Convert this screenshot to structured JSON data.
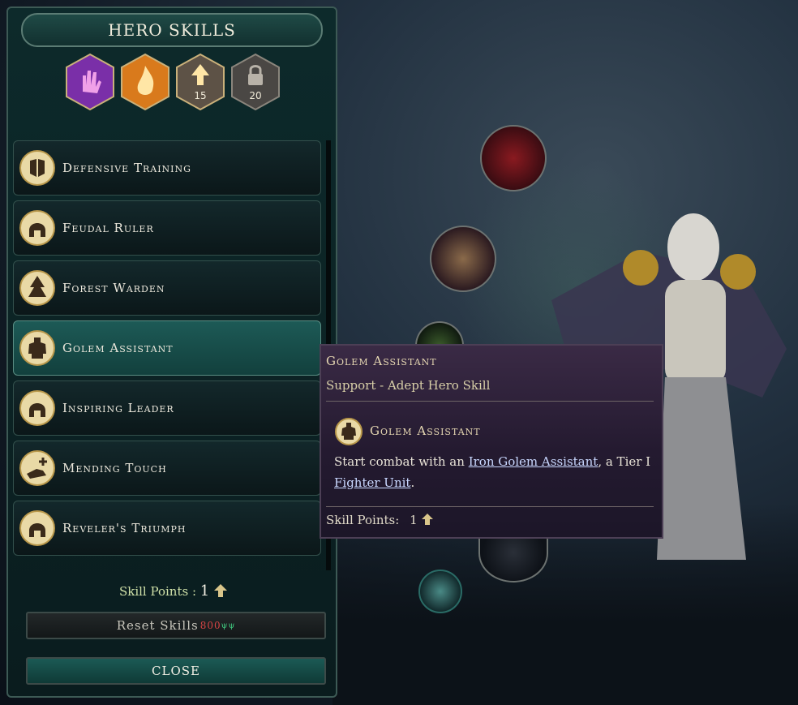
{
  "panel": {
    "title": "HERO SKILLS"
  },
  "badges": [
    {
      "icon": "magic-hand-icon",
      "color": "#7a2fa8",
      "value": ""
    },
    {
      "icon": "flame-icon",
      "color": "#d97a1c",
      "value": ""
    },
    {
      "icon": "up-arrow-icon",
      "color": "#8a7a62",
      "value": "15"
    },
    {
      "icon": "lock-icon",
      "color": "#6a6560",
      "value": "20"
    }
  ],
  "skills": [
    {
      "label": "Defensive Training",
      "icon": "shields-icon",
      "selected": false
    },
    {
      "label": "Feudal Ruler",
      "icon": "helmet-icon",
      "selected": false
    },
    {
      "label": "Forest Warden",
      "icon": "pine-trees-icon",
      "selected": false
    },
    {
      "label": "Golem Assistant",
      "icon": "golem-icon",
      "selected": true
    },
    {
      "label": "Inspiring Leader",
      "icon": "helmet-icon",
      "selected": false
    },
    {
      "label": "Mending Touch",
      "icon": "healing-hand-icon",
      "selected": false
    },
    {
      "label": "Reveler's Triumph",
      "icon": "helmet-icon",
      "selected": false
    }
  ],
  "footer": {
    "skill_points_label": "Skill Points :",
    "skill_points_value": "1",
    "reset_label": "Reset Skills",
    "reset_cost": "800",
    "close_label": "CLOSE"
  },
  "tooltip": {
    "title": "Golem Assistant",
    "subtitle": "Support - Adept Hero Skill",
    "skill_name": "Golem Assistant",
    "desc_pre": "Start combat with an ",
    "desc_link1": "Iron Golem Assistant",
    "desc_mid": ", a Tier I ",
    "desc_link2": "Fighter Unit",
    "desc_post": ".",
    "skill_points_label": "Skill Points:",
    "skill_points_value": "1"
  }
}
